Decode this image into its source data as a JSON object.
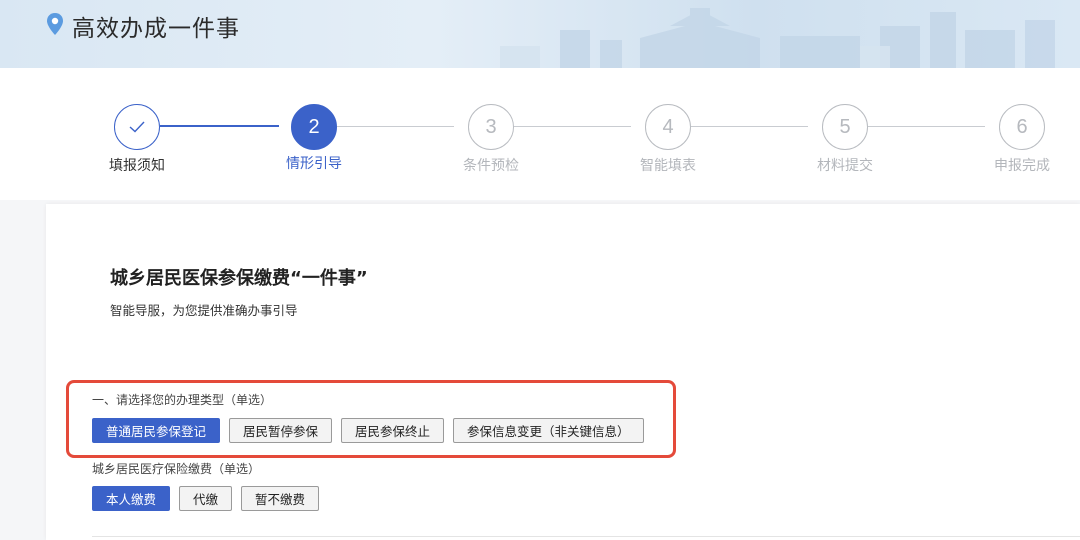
{
  "header": {
    "title": "高效办成一件事",
    "icon": "location-pin-icon",
    "accent": "#5b9be0"
  },
  "stepper": {
    "accent": "#3b62c9",
    "steps": [
      {
        "number": "✓",
        "label": "填报须知",
        "state": "done"
      },
      {
        "number": "2",
        "label": "情形引导",
        "state": "active"
      },
      {
        "number": "3",
        "label": "条件预检",
        "state": "pending"
      },
      {
        "number": "4",
        "label": "智能填表",
        "state": "pending"
      },
      {
        "number": "5",
        "label": "材料提交",
        "state": "pending"
      },
      {
        "number": "6",
        "label": "申报完成",
        "state": "pending"
      }
    ]
  },
  "main": {
    "title": "城乡居民医保参保缴费“一件事”",
    "subtitle": "智能导服，为您提供准确办事引导",
    "questions": [
      {
        "label": "一、请选择您的办理类型（单选）",
        "options": [
          "普通居民参保登记",
          "居民暂停参保",
          "居民参保终止",
          "参保信息变更（非关键信息）"
        ],
        "selected": "普通居民参保登记"
      },
      {
        "label": "城乡居民医疗保险缴费（单选）",
        "options": [
          "本人缴费",
          "代缴",
          "暂不缴费"
        ],
        "selected": "本人缴费"
      }
    ]
  }
}
